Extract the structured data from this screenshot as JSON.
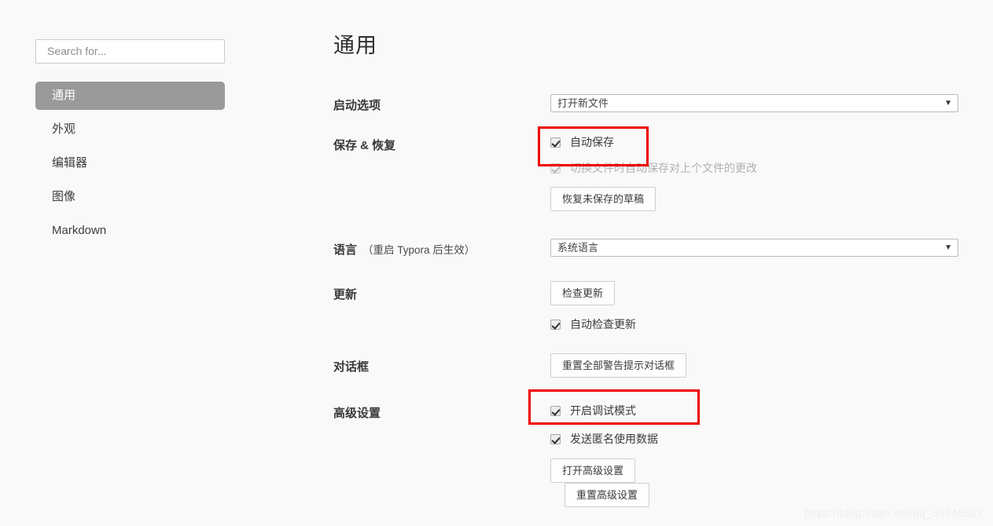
{
  "search": {
    "placeholder": "Search for...",
    "value": ""
  },
  "sidebar": {
    "items": [
      {
        "label": "通用",
        "active": true
      },
      {
        "label": "外观",
        "active": false
      },
      {
        "label": "编辑器",
        "active": false
      },
      {
        "label": "图像",
        "active": false
      },
      {
        "label": "Markdown",
        "active": false
      }
    ]
  },
  "main": {
    "title": "通用",
    "startup": {
      "label": "启动选项",
      "select_value": "打开新文件",
      "caret": "▼"
    },
    "save_restore": {
      "label": "保存 & 恢复",
      "auto_save_label": "自动保存",
      "auto_save_checked": true,
      "switch_save_label": "切换文件时自动保存对上个文件的更改",
      "switch_save_checked": true,
      "switch_save_disabled": true,
      "recover_button": "恢复未保存的草稿"
    },
    "language": {
      "label": "语言",
      "sublabel": "（重启 Typora 后生效）",
      "select_value": "系统语言",
      "caret": "▼"
    },
    "update": {
      "label": "更新",
      "check_button": "检查更新",
      "auto_check_label": "自动检查更新",
      "auto_check_checked": true
    },
    "dialog": {
      "label": "对话框",
      "reset_button": "重置全部警告提示对话框"
    },
    "advanced": {
      "label": "高级设置",
      "debug_label": "开启调试模式",
      "debug_checked": true,
      "telemetry_label": "发送匿名使用数据",
      "telemetry_checked": true,
      "open_button": "打开高级设置",
      "reset_button": "重置高级设置"
    }
  },
  "annotations": {
    "accent_color": "#ee0000",
    "boxes": [
      {
        "name": "auto-save"
      },
      {
        "name": "debug-mode"
      }
    ]
  },
  "watermark": {
    "text": "https://blog.csdn.net/qq_39749527"
  }
}
